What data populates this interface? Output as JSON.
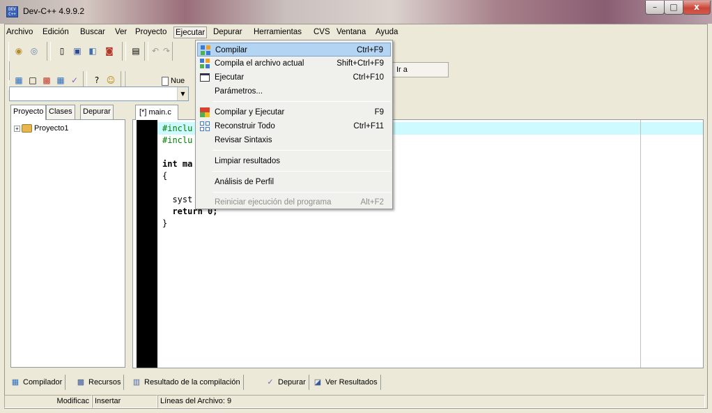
{
  "window": {
    "title": "Dev-C++ 4.9.9.2"
  },
  "caption_buttons": {
    "minimize": "–",
    "maximize": "□",
    "close": "x"
  },
  "menubar": [
    {
      "label": "Archivo"
    },
    {
      "label": "Edición"
    },
    {
      "label": "Buscar"
    },
    {
      "label": "Ver"
    },
    {
      "label": "Proyecto"
    },
    {
      "label": "Ejecutar"
    },
    {
      "label": "Depurar"
    },
    {
      "label": "Herramientas"
    },
    {
      "label": "CVS"
    },
    {
      "label": "Ventana"
    },
    {
      "label": "Ayuda"
    }
  ],
  "toolbar": {
    "nuevo": "Nue",
    "ir_a": "Ir a"
  },
  "left_tabs": {
    "proyecto": "Proyecto",
    "clases": "Clases",
    "depurar": "Depurar"
  },
  "tree": {
    "project": "Proyecto1",
    "expander": "+"
  },
  "editor": {
    "tab": "[*] main.c",
    "code_lines": [
      "#inclu",
      "#inclu",
      "",
      "int ma",
      "{",
      "",
      "  syst",
      "  return 0;",
      "}"
    ]
  },
  "run_menu": {
    "items": [
      {
        "label": "Compilar",
        "shortcut": "Ctrl+F9",
        "icon": "compile-icon"
      },
      {
        "label": "Compila el archivo actual",
        "shortcut": "Shift+Ctrl+F9",
        "icon": "compile-file-icon"
      },
      {
        "label": "Ejecutar",
        "shortcut": "Ctrl+F10",
        "icon": "run-icon"
      },
      {
        "label": "Parámetros...",
        "shortcut": ""
      },
      {
        "label": "Compilar y Ejecutar",
        "shortcut": "F9",
        "icon": "compile-run-icon"
      },
      {
        "label": "Reconstruir Todo",
        "shortcut": "Ctrl+F11",
        "icon": "rebuild-icon"
      },
      {
        "label": "Revisar Sintaxis",
        "shortcut": ""
      },
      {
        "label": "Limpiar resultados",
        "shortcut": ""
      },
      {
        "label": "Análisis de Perfil",
        "shortcut": ""
      },
      {
        "label": "Reiniciar ejecución del programa",
        "shortcut": "Alt+F2"
      }
    ]
  },
  "bottom_tabs": [
    {
      "label": "Compilador",
      "icon": "compiler-icon"
    },
    {
      "label": "Recursos",
      "icon": "resources-icon"
    },
    {
      "label": "Resultado de la compilación",
      "icon": "bar-chart-icon"
    },
    {
      "label": "Depurar",
      "icon": "checkmark-icon"
    },
    {
      "label": "Ver Resultados",
      "icon": "view-results-icon"
    }
  ],
  "statusbar": {
    "mode": "Modificac",
    "insert": "Insertar",
    "lines": "Líneas del Archivo: 9"
  }
}
